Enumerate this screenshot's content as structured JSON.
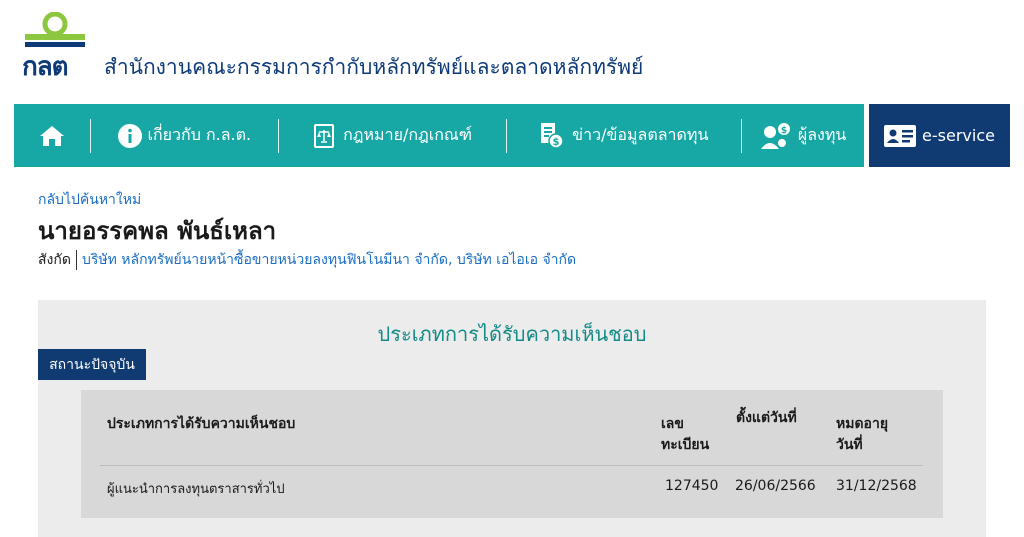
{
  "header": {
    "logo_text": "กลต",
    "org_name": "สำนักงานคณะกรรมการกำกับหลักทรัพย์และตลาดหลักทรัพย์"
  },
  "nav": {
    "home_icon": "home-icon",
    "items": [
      {
        "label": "เกี่ยวกับ ก.ล.ต.",
        "icon": "info-icon"
      },
      {
        "label": "กฎหมาย/กฎเกณฑ์",
        "icon": "law-book-icon"
      },
      {
        "label": "ข่าว/ข้อมูลตลาดทุน",
        "icon": "news-money-icon"
      },
      {
        "label": "ผู้ลงทุน",
        "icon": "investor-icon"
      }
    ],
    "eservice_label": "e-service",
    "eservice_icon": "id-card-icon"
  },
  "profile": {
    "back_link": "กลับไปค้นหาใหม่",
    "name": "นายอรรคพล พันธ์เหลา",
    "affiliation_label": "สังกัด",
    "affiliation_value": "บริษัท หลักทรัพย์นายหน้าซื้อขายหน่วยลงทุนฟินโนมีนา จำกัด, บริษัท เอไอเอ จำกัด"
  },
  "approval": {
    "title": "ประเภทการได้รับความเห็นชอบ",
    "status_tab": "สถานะปัจจุบัน",
    "columns": {
      "type": "ประเภทการได้รับความเห็นชอบ",
      "reg_no": "เลขทะเบียน",
      "from_date": "ตั้งแต่วันที่",
      "expiry": "หมดอายุวันที่"
    },
    "columns_display": {
      "reg_no_line1": "เลข",
      "reg_no_line2": "ทะเบียน",
      "expiry_line1": "หมดอายุ",
      "expiry_line2": "วันที่"
    },
    "rows": [
      {
        "type": "ผู้แนะนำการลงทุนตราสารทั่วไป",
        "reg_no": "127450",
        "from_date": "26/06/2566",
        "expiry": "31/12/2568"
      }
    ]
  },
  "colors": {
    "nav_bg": "#17a8a6",
    "eservice_bg": "#0f3b72",
    "brand_navy": "#0e3a78",
    "link_blue": "#1b6fc4",
    "title_teal": "#138b86",
    "logo_green": "#8dc63f"
  }
}
